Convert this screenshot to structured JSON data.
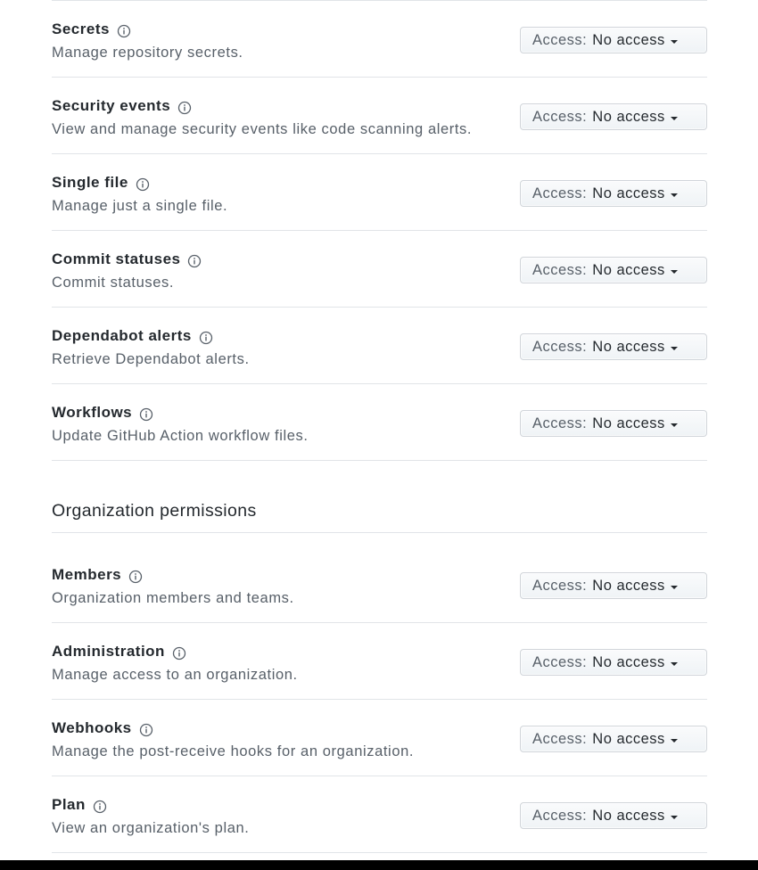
{
  "access_label": "Access:",
  "repository_permissions": [
    {
      "title": "Secrets",
      "description": "Manage repository secrets.",
      "access": "No access"
    },
    {
      "title": "Security events",
      "description": "View and manage security events like code scanning alerts.",
      "access": "No access"
    },
    {
      "title": "Single file",
      "description": "Manage just a single file.",
      "access": "No access"
    },
    {
      "title": "Commit statuses",
      "description": "Commit statuses.",
      "access": "No access"
    },
    {
      "title": "Dependabot alerts",
      "description": "Retrieve Dependabot alerts.",
      "access": "No access"
    },
    {
      "title": "Workflows",
      "description": "Update GitHub Action workflow files.",
      "access": "No access"
    }
  ],
  "organization_section": {
    "heading": "Organization permissions",
    "permissions": [
      {
        "title": "Members",
        "description": "Organization members and teams.",
        "access": "No access"
      },
      {
        "title": "Administration",
        "description": "Manage access to an organization.",
        "access": "No access"
      },
      {
        "title": "Webhooks",
        "description": "Manage the post-receive hooks for an organization.",
        "access": "No access"
      },
      {
        "title": "Plan",
        "description": "View an organization's plan.",
        "access": "No access"
      }
    ]
  },
  "icons": {
    "info": "info-icon",
    "dropdown": "caret-down-icon"
  }
}
